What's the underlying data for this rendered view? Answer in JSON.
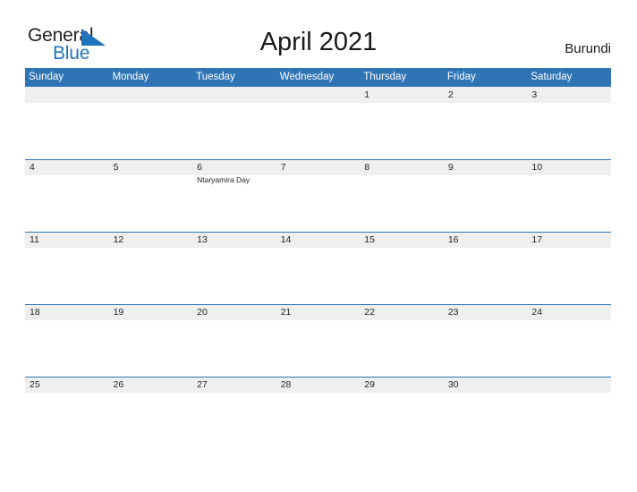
{
  "brand": {
    "name_part1": "General",
    "name_part2": "Blue",
    "triangle_color": "#1f74bd",
    "text_color": "#231f20"
  },
  "header": {
    "title": "April 2021",
    "country": "Burundi"
  },
  "colors": {
    "header_blue": "#2f74b5",
    "band_gray": "#efeff0",
    "text": "#231f20",
    "weekday_text": "#ffffff"
  },
  "calendar": {
    "month": "April",
    "year": "2021",
    "weekdays": [
      "Sunday",
      "Monday",
      "Tuesday",
      "Wednesday",
      "Thursday",
      "Friday",
      "Saturday"
    ],
    "weeks": [
      [
        {
          "day": ""
        },
        {
          "day": ""
        },
        {
          "day": ""
        },
        {
          "day": ""
        },
        {
          "day": "1"
        },
        {
          "day": "2"
        },
        {
          "day": "3"
        }
      ],
      [
        {
          "day": "4"
        },
        {
          "day": "5"
        },
        {
          "day": "6",
          "events": [
            "Ntaryamira Day"
          ]
        },
        {
          "day": "7"
        },
        {
          "day": "8"
        },
        {
          "day": "9"
        },
        {
          "day": "10"
        }
      ],
      [
        {
          "day": "11"
        },
        {
          "day": "12"
        },
        {
          "day": "13"
        },
        {
          "day": "14"
        },
        {
          "day": "15"
        },
        {
          "day": "16"
        },
        {
          "day": "17"
        }
      ],
      [
        {
          "day": "18"
        },
        {
          "day": "19"
        },
        {
          "day": "20"
        },
        {
          "day": "21"
        },
        {
          "day": "22"
        },
        {
          "day": "23"
        },
        {
          "day": "24"
        }
      ],
      [
        {
          "day": "25"
        },
        {
          "day": "26"
        },
        {
          "day": "27"
        },
        {
          "day": "28"
        },
        {
          "day": "29"
        },
        {
          "day": "30"
        },
        {
          "day": ""
        }
      ]
    ]
  }
}
